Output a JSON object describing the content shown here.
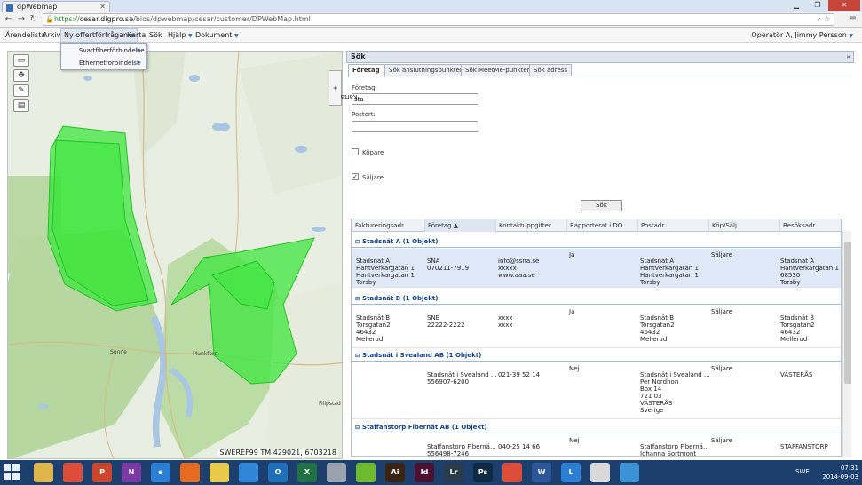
{
  "browser": {
    "tab_title": "dpWebmap",
    "url_scheme": "https://",
    "url_domain": "cesar.digpro.se",
    "url_path": "/bios/dpwebmap/cesar/customer/DPWebMap.html",
    "zoom_icons": "⌕ ☆"
  },
  "menubar": {
    "items": [
      "Ärendelista",
      "Arkiv",
      "Ny offertförfrågan",
      "Karta",
      "Sök",
      "Hjälp",
      "Dokument"
    ],
    "operator": "Operatör A, Jimmy Persson"
  },
  "dropdown": {
    "items": [
      "Svartfiberförbindelse",
      "Ethernetförbindelse"
    ]
  },
  "map": {
    "coordinates": "SWEREF99 TM 429021, 6703218",
    "side_tab": "Karta",
    "tools": [
      "zoom-box-icon",
      "pan-icon",
      "draw-icon",
      "print-icon"
    ],
    "polygon_color": "#3ee63e",
    "place_labels": [
      "Sunne",
      "Munkfors",
      "Filipstad"
    ]
  },
  "panel": {
    "title": "Sök",
    "tabs": [
      "Företag",
      "Sök anslutningspunkter",
      "Sök MeetMe-punkter",
      "Sök adress"
    ],
    "company_label": "Företag:",
    "company_value": "sta",
    "postal_label": "Postort:",
    "postal_value": "",
    "buyer_label": "Köpare",
    "seller_label": "Säljare",
    "search_button": "Sök"
  },
  "grid": {
    "columns": [
      "Faktureringsadr",
      "Företag ▲",
      "Kontaktuppgifter",
      "Rapporterat i DO",
      "Postadr",
      "Köp/Sälj",
      "Besöksadr"
    ],
    "groups": [
      {
        "title": "Stadsnät A (1 Objekt)",
        "row": {
          "faktureringsadr": "Stadsnät A\nHantverkargatan 1\nHantverkargatan 1\nTorsby",
          "foretag": "SNA\n070211-7919",
          "kontakt": "info@ssna.se\nxxxxx\nwww.aaa.se",
          "rapporterat": "Ja",
          "postadr": "Stadsnät A\nHantverkargatan 1\nHantverkargatan 1\nTorsby",
          "kopsalj": "Säljare",
          "besoksadr": "Stadsnät A\nHantverkargatan 1\n68530\nTorsby"
        }
      },
      {
        "title": "Stadsnät B (1 Objekt)",
        "row": {
          "faktureringsadr": "Stadsnät B\nTorsgatan2\n46432\nMellerud",
          "foretag": "SNB\n22222-2222",
          "kontakt": "xxxx\nxxxx",
          "rapporterat": "Ja",
          "postadr": "Stadsnät B\nTorsgatan2\n46432\nMellerud",
          "kopsalj": "Säljare",
          "besoksadr": "Stadsnät B\nTorsgatan2\n46432\nMellerud"
        }
      },
      {
        "title": "Stadsnät i Svealand AB (1 Objekt)",
        "row": {
          "faktureringsadr": "",
          "foretag": "Stadsnät i Svealand ...\n556907-6200",
          "kontakt": "021-39 52 14",
          "rapporterat": "Nej",
          "postadr": "Stadsnät i Svealand ...\nPer Nordhon\nBox 14\n721 03\nVÄSTERÅS\nSverige",
          "kopsalj": "Säljare",
          "besoksadr": "VÄSTERÅS"
        }
      },
      {
        "title": "Staffanstorp Fibernät AB (1 Objekt)",
        "row": {
          "faktureringsadr": "",
          "foretag": "Staffanstorp Fibernä...\n556498-7246",
          "kontakt": "040-25 14 66",
          "rapporterat": "Nej",
          "postadr": "Staffanstorp Fibernä...\nJohanna Sortmont",
          "kopsalj": "Säljare",
          "besoksadr": "STAFFANSTORP"
        }
      }
    ]
  },
  "taskbar": {
    "apps": [
      {
        "name": "explorer",
        "label": "",
        "color": "#e0b54a"
      },
      {
        "name": "chrome",
        "label": "",
        "color": "#dd4b39"
      },
      {
        "name": "powerpoint",
        "label": "P",
        "color": "#c9462c"
      },
      {
        "name": "onenote",
        "label": "N",
        "color": "#7b3aa3"
      },
      {
        "name": "internet-explorer",
        "label": "e",
        "color": "#2a7fd4"
      },
      {
        "name": "firefox",
        "label": "",
        "color": "#e66b1f"
      },
      {
        "name": "notes",
        "label": "",
        "color": "#e8c94a"
      },
      {
        "name": "dropbox",
        "label": "",
        "color": "#2f86d8"
      },
      {
        "name": "outlook",
        "label": "O",
        "color": "#1f6fb8"
      },
      {
        "name": "excel",
        "label": "X",
        "color": "#207245"
      },
      {
        "name": "app",
        "label": "",
        "color": "#9aa3ad"
      },
      {
        "name": "spotify",
        "label": "",
        "color": "#6fbb2e"
      },
      {
        "name": "illustrator",
        "label": "Ai",
        "color": "#3b2414"
      },
      {
        "name": "indesign",
        "label": "Id",
        "color": "#4a1230"
      },
      {
        "name": "lightroom",
        "label": "Lr",
        "color": "#2a3b4b"
      },
      {
        "name": "photoshop",
        "label": "Ps",
        "color": "#0f2a44"
      },
      {
        "name": "chrome-2",
        "label": "",
        "color": "#dd4b39"
      },
      {
        "name": "word",
        "label": "W",
        "color": "#2b579a"
      },
      {
        "name": "lync",
        "label": "L",
        "color": "#2a7fd4"
      },
      {
        "name": "app-2",
        "label": "",
        "color": "#d9d9d9"
      },
      {
        "name": "app-3",
        "label": "",
        "color": "#3b93d6"
      }
    ],
    "lang": "SWE",
    "time": "07:31",
    "date": "2014-09-03"
  }
}
